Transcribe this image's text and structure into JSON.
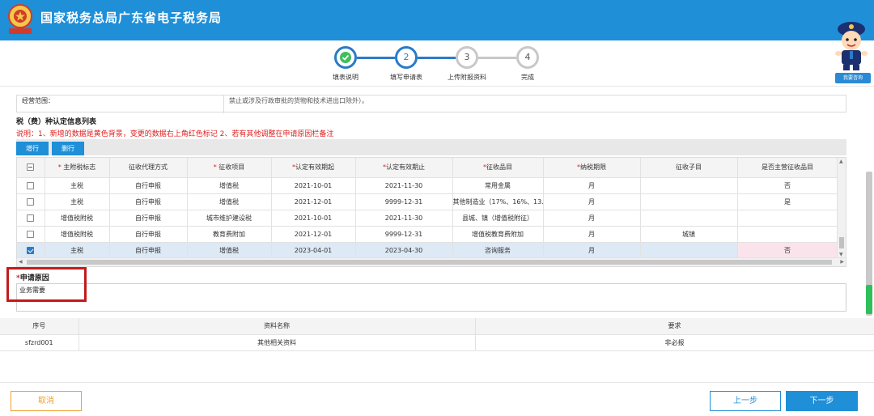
{
  "header": {
    "title": "国家税务总局广东省电子税务局",
    "logo_text": "中国税务"
  },
  "stepper": {
    "steps": [
      {
        "num": "",
        "label": "填表说明",
        "state": "done"
      },
      {
        "num": "2",
        "label": "填写申请表",
        "state": "active"
      },
      {
        "num": "3",
        "label": "上传附报资料",
        "state": "todo"
      },
      {
        "num": "4",
        "label": "完成",
        "state": "todo"
      }
    ]
  },
  "mascot": {
    "consult_label": "我要咨询"
  },
  "scope": {
    "label": "经营范围：",
    "text": "禁止或涉及行政审批的货物和技术进出口除外）。"
  },
  "section": {
    "title": "税（费）种认定信息列表",
    "notice": "说明：1、新增的数据是黄色背景，变更的数据右上角红色标记 2、若有其他调整在申请原因栏备注"
  },
  "toolbar": {
    "add_label": "增行",
    "delete_label": "删行"
  },
  "grid": {
    "headers": [
      "主附税标志",
      "征收代理方式",
      "征收项目",
      "认定有效期起",
      "认定有效期止",
      "征收品目",
      "纳税期限",
      "征收子目",
      "是否主营征收品目"
    ],
    "required": [
      true,
      false,
      true,
      true,
      true,
      true,
      true,
      false,
      false
    ],
    "rows": [
      {
        "checked": false,
        "cells": [
          "主税",
          "自行申报",
          "增值税",
          "2021-10-01",
          "2021-11-30",
          "常用金属",
          "月",
          "",
          "否"
        ]
      },
      {
        "checked": false,
        "cells": [
          "主税",
          "自行申报",
          "增值税",
          "2021-12-01",
          "9999-12-31",
          "其他制造业（17%、16%、13...",
          "月",
          "",
          "是"
        ]
      },
      {
        "checked": false,
        "cells": [
          "增值税附税",
          "自行申报",
          "城市维护建设税",
          "2021-10-01",
          "2021-11-30",
          "县城、镇（增值税附征）",
          "月",
          "",
          ""
        ]
      },
      {
        "checked": false,
        "cells": [
          "增值税附税",
          "自行申报",
          "教育费附加",
          "2021-12-01",
          "9999-12-31",
          "增值税教育费附加",
          "月",
          "城镇",
          ""
        ]
      },
      {
        "checked": true,
        "cells": [
          "主税",
          "自行申报",
          "增值税",
          "2023-04-01",
          "2023-04-30",
          "咨询服务",
          "月",
          "",
          "否"
        ]
      }
    ]
  },
  "reason": {
    "label": "申请原因",
    "value": "业务需要"
  },
  "materials": {
    "headers": [
      "序号",
      "资料名称",
      "要求"
    ],
    "rows": [
      [
        "sfzrd001",
        "其他相关资料",
        "非必报"
      ]
    ]
  },
  "footer": {
    "cancel_label": "取消",
    "prev_label": "上一步",
    "next_label": "下一步"
  },
  "colors": {
    "brand": "#1f8fd8",
    "notice": "#e02020",
    "highlight_box": "#c21b1b",
    "cancel": "#f0a030"
  }
}
